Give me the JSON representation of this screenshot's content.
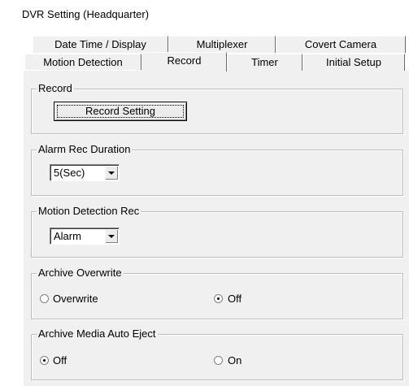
{
  "window": {
    "title": "DVR Setting  (Headquarter)"
  },
  "tabs": {
    "row1": [
      {
        "label": "Date Time / Display"
      },
      {
        "label": "Multiplexer"
      },
      {
        "label": "Covert Camera"
      }
    ],
    "row2": [
      {
        "label": "Motion Detection"
      },
      {
        "label": "Record",
        "active": true
      },
      {
        "label": "Timer"
      },
      {
        "label": "Initial Setup"
      }
    ]
  },
  "record": {
    "legend": "Record",
    "button_label": "Record Setting"
  },
  "alarm_rec_duration": {
    "legend": "Alarm Rec Duration",
    "value": "5(Sec)"
  },
  "motion_detection_rec": {
    "legend": "Motion Detection Rec",
    "value": "Alarm"
  },
  "archive_overwrite": {
    "legend": "Archive Overwrite",
    "options": [
      {
        "label": "Overwrite",
        "checked": false
      },
      {
        "label": "Off",
        "checked": true
      }
    ]
  },
  "archive_media_auto_eject": {
    "legend": "Archive Media Auto Eject",
    "options": [
      {
        "label": "Off",
        "checked": true
      },
      {
        "label": "On",
        "checked": false
      }
    ]
  },
  "colors": {
    "panel_bg": "#f0f0f0",
    "group_border": "#bdbdbd"
  }
}
